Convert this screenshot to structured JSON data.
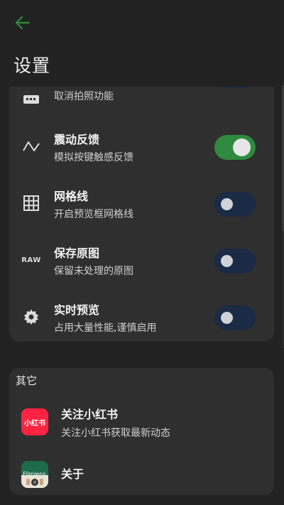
{
  "header": {
    "title": "设置"
  },
  "settings": {
    "items": [
      {
        "title": "",
        "subtitle": "取消拍照功能",
        "icon": "camera-off-icon",
        "enabled": false
      },
      {
        "title": "震动反馈",
        "subtitle": "模拟按键触感反馈",
        "icon": "vibration-wave-icon",
        "enabled": true
      },
      {
        "title": "网格线",
        "subtitle": "开启预览框网格线",
        "icon": "grid-icon",
        "enabled": false
      },
      {
        "title": "保存原图",
        "subtitle": "保留未处理的原图",
        "icon": "raw-icon",
        "icon_text": "RAW",
        "enabled": false
      },
      {
        "title": "实时预览",
        "subtitle": "占用大量性能,谨慎启用",
        "icon": "gear-icon",
        "enabled": false
      }
    ]
  },
  "other": {
    "section_title": "其它",
    "xiaohongshu": {
      "title": "关注小红书",
      "subtitle": "关注小红书获取最新动态",
      "icon_text": "小红书"
    },
    "about": {
      "title": "关于",
      "icon_text": "Filmlens"
    }
  },
  "colors": {
    "background": "#222222",
    "card": "#2f2f2f",
    "accent_green": "#2f8a3f",
    "toggle_off": "#1b2a45",
    "xiaohongshu_red": "#ff2442"
  }
}
